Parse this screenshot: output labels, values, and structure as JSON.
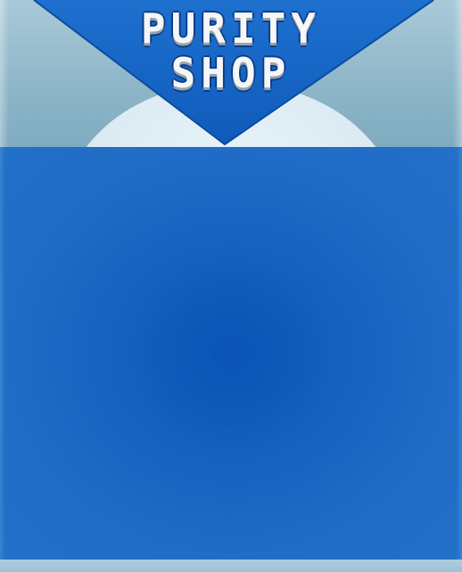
{
  "shop": {
    "title_line1": "PURITY",
    "title_line2": "SHOP"
  },
  "colors": {
    "banner_blue": "#1a66c6",
    "panel_blue": "#1f6dc6",
    "header_bg": "#8fb7c9",
    "title_text": "#f4f6f8"
  }
}
